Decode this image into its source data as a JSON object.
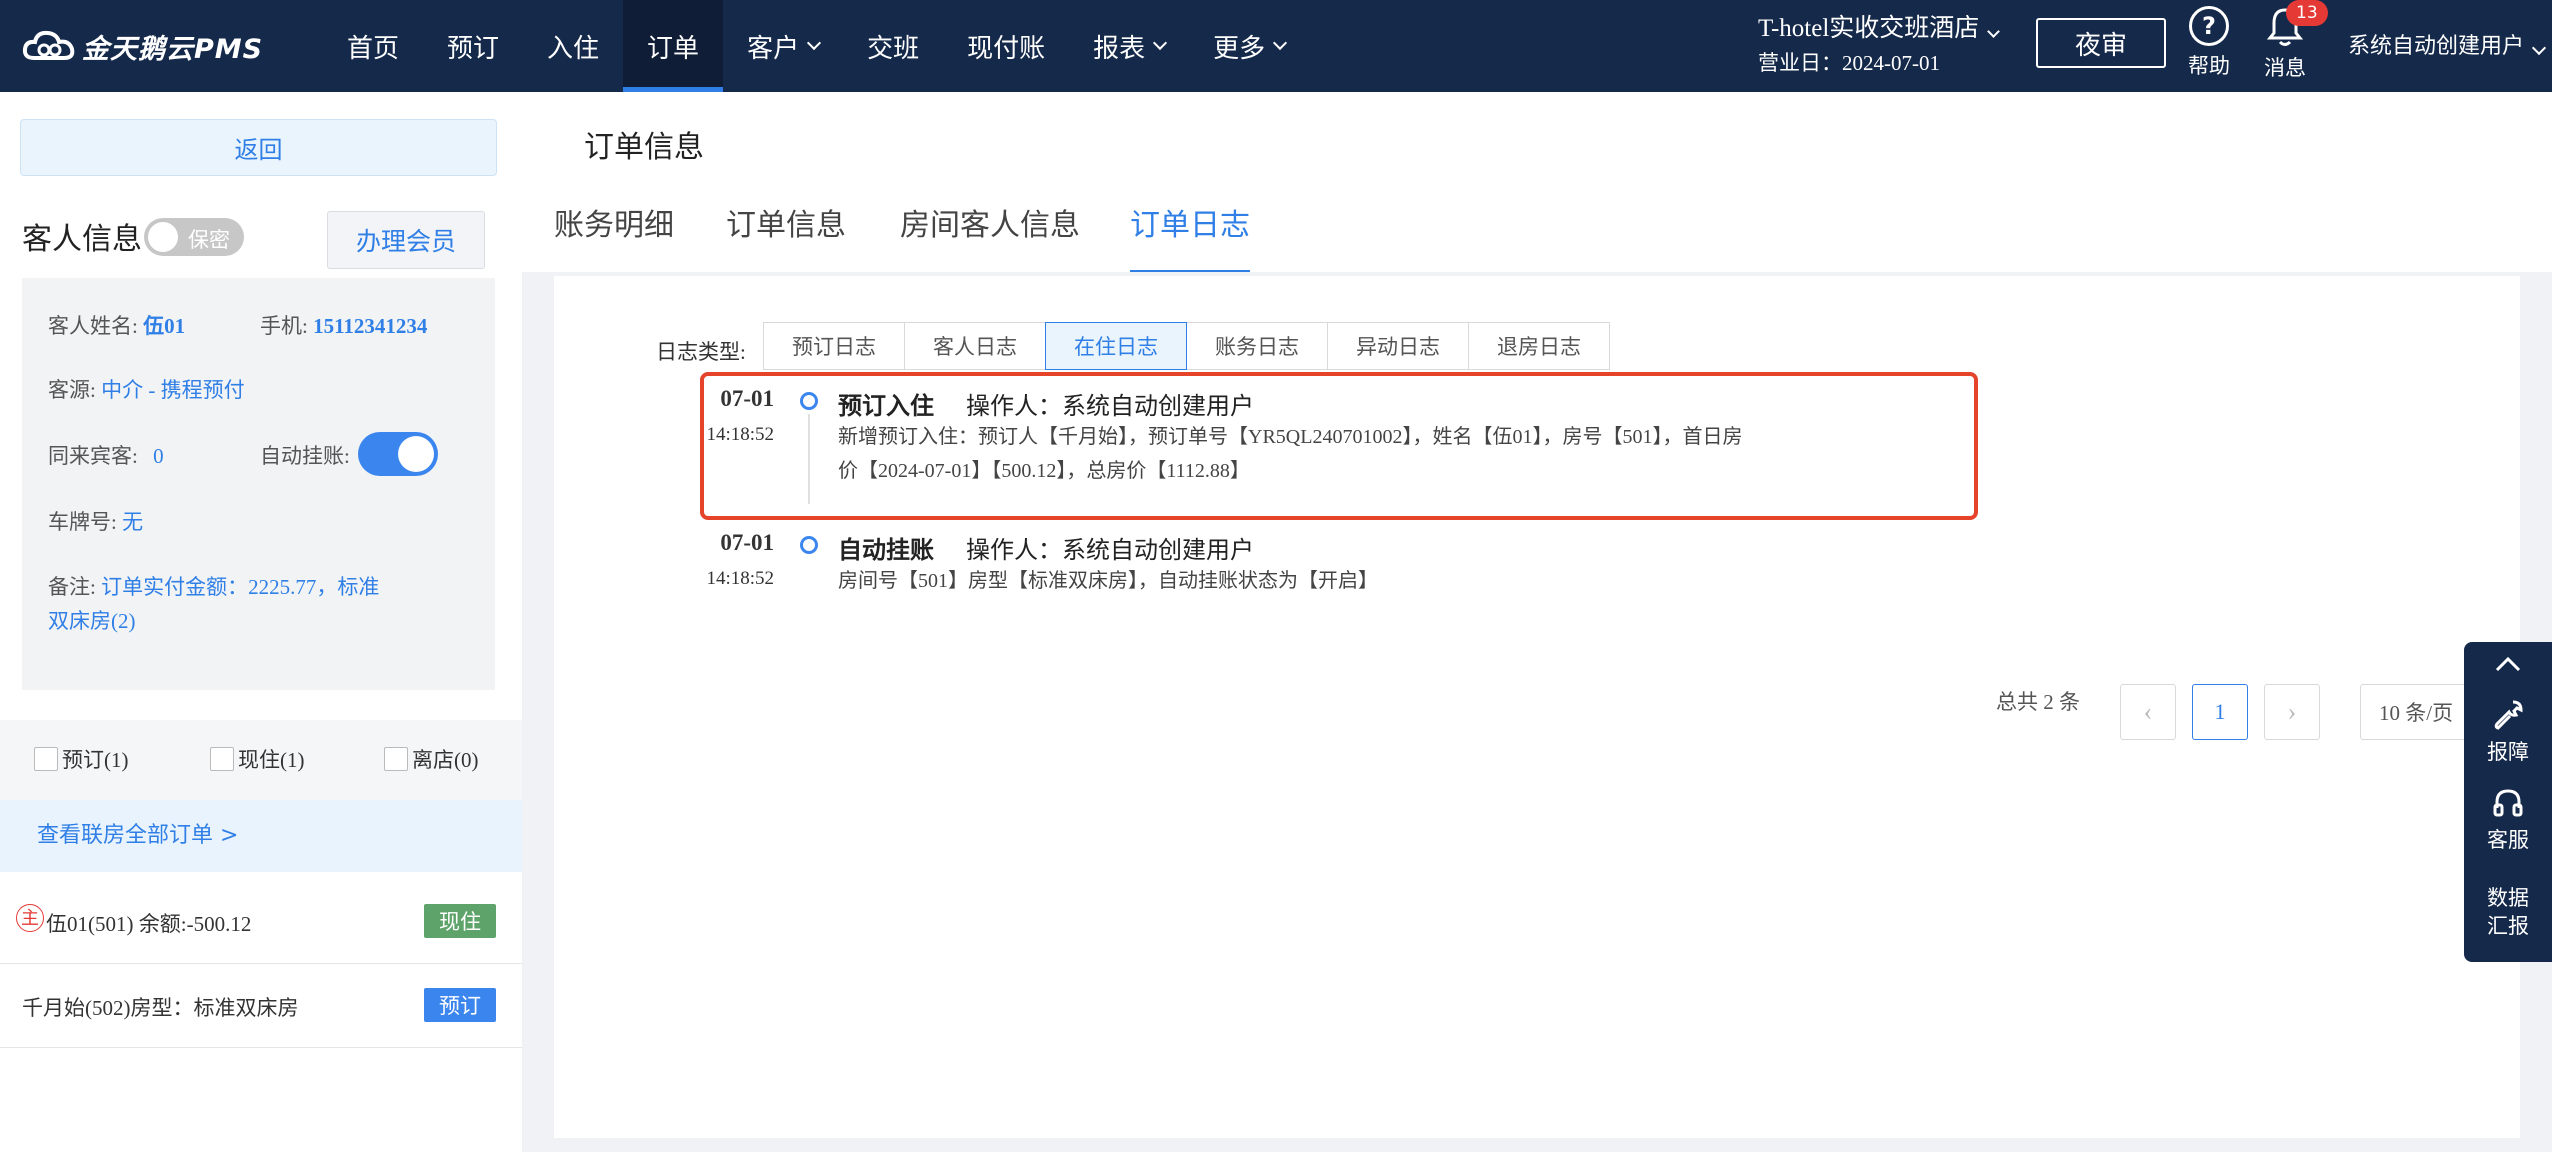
{
  "app": {
    "logo_text": "金天鹅云PMS",
    "nav": [
      "首页",
      "预订",
      "入住",
      "订单",
      "客户",
      "交班",
      "现付账",
      "报表",
      "更多"
    ],
    "nav_active": "订单",
    "hotel_name": "T-hotel实收交班酒店",
    "business_day": "营业日：2024-07-01",
    "night_audit": "夜审",
    "help": "帮助",
    "messages": "消息",
    "message_count": "13",
    "user": "系统自动创建用户"
  },
  "sidebar": {
    "back": "返回",
    "guest_title": "客人信息",
    "secret_label": "保密",
    "member_button": "办理会员",
    "guest_name_label": "客人姓名:",
    "guest_name": "伍01",
    "phone_label": "手机:",
    "phone": "15112341234",
    "source_label": "客源:",
    "source": "中介 - 携程预付",
    "companions_label": "同来宾客:",
    "companions": "0",
    "auto_charge_label": "自动挂账:",
    "auto_charge_on": true,
    "plate_label": "车牌号:",
    "plate": "无",
    "remark_label": "备注:",
    "remark_line1": "订单实付金额：2225.77，标准",
    "remark_line2": "双床房(2)",
    "filters": [
      "预订(1)",
      "现住(1)",
      "离店(0)"
    ],
    "view_all": "查看联房全部订单 >",
    "orders": [
      {
        "mark": "主",
        "text": "伍01(501)   余额:-500.12",
        "status": "现住",
        "status_color": "#5ea36a"
      },
      {
        "mark": "",
        "text": "千月始(502)房型：标准双床房",
        "status": "预订",
        "status_color": "#3b86ee"
      }
    ]
  },
  "main": {
    "page_title": "订单信息",
    "tabs": [
      "账务明细",
      "订单信息",
      "房间客人信息",
      "订单日志"
    ],
    "active_tab": "订单日志",
    "log_type_label": "日志类型:",
    "log_tabs": [
      "预订日志",
      "客人日志",
      "在住日志",
      "账务日志",
      "异动日志",
      "退房日志"
    ],
    "active_log_tab": "在住日志",
    "logs": [
      {
        "date": "07-01",
        "time": "14:18:52",
        "title": "预订入住",
        "operator": "操作人：系统自动创建用户",
        "desc_line1": "新增预订入住：预订人【千月始】，预订单号【YR5QL240701002】，姓名【伍01】，房号【501】，首日房",
        "desc_line2": "价【2024-07-01】【500.12】，总房价【1112.88】"
      },
      {
        "date": "07-01",
        "time": "14:18:52",
        "title": "自动挂账",
        "operator": "操作人：系统自动创建用户",
        "desc_line1": "房间号【501】房型【标准双床房】，自动挂账状态为【开启】",
        "desc_line2": ""
      }
    ],
    "pagination": {
      "total": "总共 2 条",
      "page": "1",
      "page_size": "10 条/页"
    }
  },
  "float_panel": {
    "items": [
      "报障",
      "客服",
      "数据",
      "汇报"
    ]
  },
  "colors": {
    "topbar": "#15294a",
    "accent": "#2f7fe6",
    "highlight": "#e5432a"
  }
}
